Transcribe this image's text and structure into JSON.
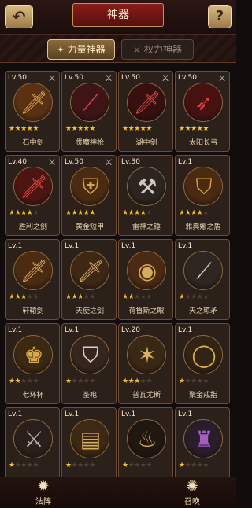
{
  "header": {
    "title": "神器"
  },
  "tabs": {
    "active_label": "力量神器",
    "inactive_label": "权力神器"
  },
  "cards": [
    {
      "level": "Lv.50",
      "name": "石中剑",
      "stars": 5,
      "icon": "sword-icon",
      "color": "#d9a64b",
      "glow": "#5b3114",
      "crossed": true
    },
    {
      "level": "Lv.50",
      "name": "贯魔神枪",
      "stars": 5,
      "icon": "spear-icon",
      "color": "#d5474d",
      "glow": "#3f1416",
      "crossed": true
    },
    {
      "level": "Lv.50",
      "name": "湖中剑",
      "stars": 5,
      "icon": "sword-icon",
      "color": "#d74744",
      "glow": "#36100f",
      "crossed": true
    },
    {
      "level": "Lv.50",
      "name": "太阳长弓",
      "stars": 5,
      "icon": "bow-icon",
      "color": "#e13c3a",
      "glow": "#451111",
      "crossed": true
    },
    {
      "level": "Lv.40",
      "name": "胜利之剑",
      "stars": 4,
      "icon": "sword-icon",
      "color": "#e24c40",
      "glow": "#4c1512",
      "crossed": true
    },
    {
      "level": "Lv.50",
      "name": "黄金短甲",
      "stars": 5,
      "icon": "armor-icon",
      "color": "#d7a44b",
      "glow": "#4a2b11",
      "crossed": true
    },
    {
      "level": "Lv.30",
      "name": "雷神之锤",
      "stars": 4,
      "icon": "hammer-icon",
      "color": "#d2c7bf",
      "glow": "#2c2420",
      "crossed": false
    },
    {
      "level": "Lv.1",
      "name": "雅典娜之盾",
      "stars": 4,
      "icon": "shield-icon",
      "color": "#d2a648",
      "glow": "#4a2b12",
      "crossed": false
    },
    {
      "level": "Lv.1",
      "name": "轩辕剑",
      "stars": 3,
      "icon": "sword-icon",
      "color": "#d9ad57",
      "glow": "#4b2b12",
      "crossed": false
    },
    {
      "level": "Lv.1",
      "name": "天使之剑",
      "stars": 3,
      "icon": "sword-icon",
      "color": "#d7b069",
      "glow": "#3e2714",
      "crossed": false
    },
    {
      "level": "Lv.1",
      "name": "荷鲁斯之眼",
      "stars": 2,
      "icon": "eye-icon",
      "color": "#d5ab5d",
      "glow": "#4a2a13",
      "crossed": false
    },
    {
      "level": "Lv.1",
      "name": "天之琼矛",
      "stars": 1,
      "icon": "blade-icon",
      "color": "#d8d0c0",
      "glow": "#2f2521",
      "crossed": false
    },
    {
      "level": "Lv.1",
      "name": "七环杯",
      "stars": 2,
      "icon": "cup-icon",
      "color": "#d7a94b",
      "glow": "#3c2913",
      "crossed": false
    },
    {
      "level": "Lv.1",
      "name": "圣袍",
      "stars": 1,
      "icon": "robe-icon",
      "color": "#e4cfc0",
      "glow": "#35251f",
      "crossed": false
    },
    {
      "level": "Lv.20",
      "name": "普瓦尤斯",
      "stars": 3,
      "icon": "staff-icon",
      "color": "#d6b35d",
      "glow": "#3a2816",
      "crossed": false
    },
    {
      "level": "Lv.1",
      "name": "聚金戒指",
      "stars": 1,
      "icon": "ring-icon",
      "color": "#d9ac51",
      "glow": "#322414",
      "crossed": false
    },
    {
      "level": "Lv.1",
      "name": "",
      "stars": 1,
      "icon": "dagger-icon",
      "color": "#b7b0b2",
      "glow": "#2b1f1b",
      "crossed": false
    },
    {
      "level": "Lv.1",
      "name": "",
      "stars": 1,
      "icon": "book-icon",
      "color": "#d7ae5a",
      "glow": "#3d2915",
      "crossed": false
    },
    {
      "level": "Lv.1",
      "name": "",
      "stars": 1,
      "icon": "lamp-icon",
      "color": "#d9b255",
      "glow": "#1f1710",
      "crossed": false
    },
    {
      "level": "Lv.1",
      "name": "",
      "stars": 1,
      "icon": "cloak-icon",
      "color": "#a25fc0",
      "glow": "#2a1d2b",
      "crossed": false
    }
  ],
  "bottom": {
    "left_label": "法阵",
    "right_label": "召唤"
  }
}
